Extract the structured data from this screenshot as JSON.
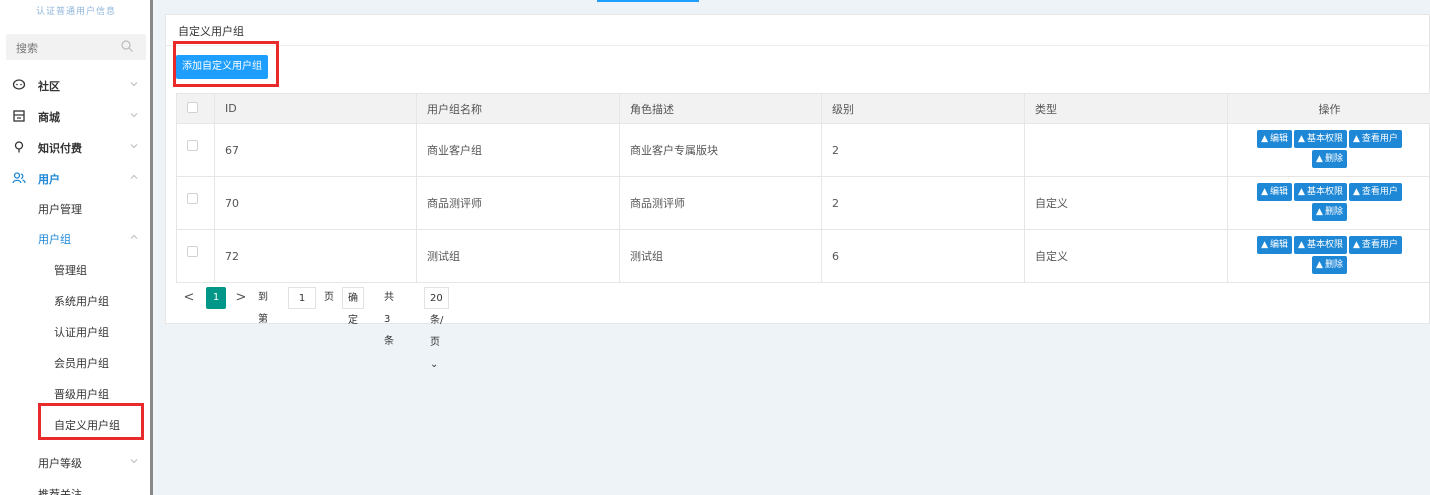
{
  "sidebar": {
    "logo_text": "认证普通用户信息",
    "search_placeholder": "搜索",
    "menu": [
      {
        "label": "社区",
        "icon": "chat-icon"
      },
      {
        "label": "商城",
        "icon": "shop-icon"
      },
      {
        "label": "知识付费",
        "icon": "bulb-icon"
      },
      {
        "label": "用户",
        "icon": "users-icon"
      }
    ],
    "user_submenu": {
      "user_management": "用户管理",
      "user_group": "用户组",
      "groups": [
        "管理组",
        "系统用户组",
        "认证用户组",
        "会员用户组",
        "晋级用户组",
        "自定义用户组"
      ],
      "user_level": "用户等级",
      "recommend_follow": "推荐关注"
    }
  },
  "main": {
    "title": "自定义用户组",
    "add_button": "添加自定义用户组",
    "columns": [
      "ID",
      "用户组名称",
      "角色描述",
      "级别",
      "类型",
      "操作"
    ],
    "rows": [
      {
        "id": "67",
        "name": "商业客户组",
        "desc": "商业客户专属版块",
        "level": "2",
        "type": ""
      },
      {
        "id": "70",
        "name": "商品测评师",
        "desc": "商品测评师",
        "level": "2",
        "type": "自定义"
      },
      {
        "id": "72",
        "name": "测试组",
        "desc": "测试组",
        "level": "6",
        "type": "自定义"
      }
    ],
    "row_actions": {
      "edit": "编辑",
      "permissions": "基本权限",
      "view_users": "查看用户",
      "delete": "删除"
    }
  },
  "pagination": {
    "prev": "<",
    "current_page": "1",
    "next": ">",
    "goto_label": "到第",
    "goto_value": "1",
    "page_unit": "页",
    "confirm": "确定",
    "total": "共 3 条",
    "page_size": "20 条/页"
  },
  "colors": {
    "accent": "#1e87d6",
    "highlight": "#e82a2a",
    "page_active": "#009688"
  }
}
